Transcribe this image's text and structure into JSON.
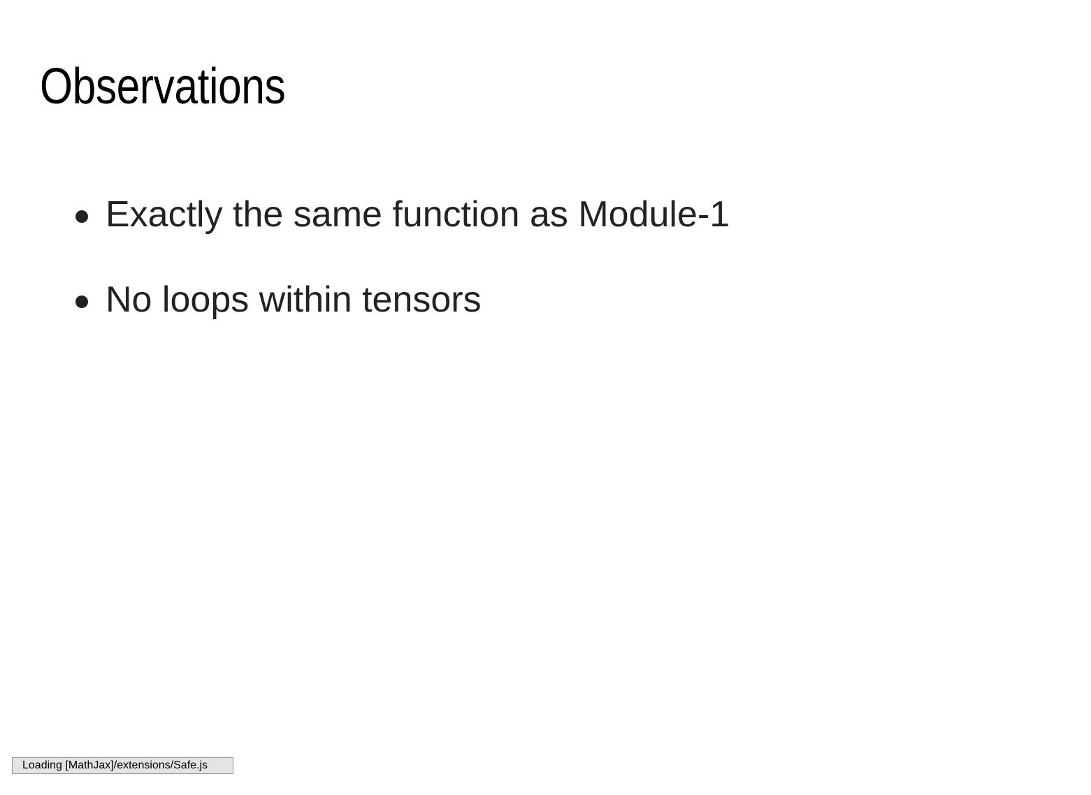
{
  "slide": {
    "title": "Observations",
    "bullets": [
      {
        "text": "Exactly the same function as Module-1"
      },
      {
        "text": "No loops within tensors"
      }
    ]
  },
  "status": {
    "message": "Loading [MathJax]/extensions/Safe.js"
  },
  "colors": {
    "background": "#ffffff",
    "title": "#000000",
    "body_text": "#222222",
    "status_background": "#e4e4e4",
    "status_border": "#959595"
  }
}
